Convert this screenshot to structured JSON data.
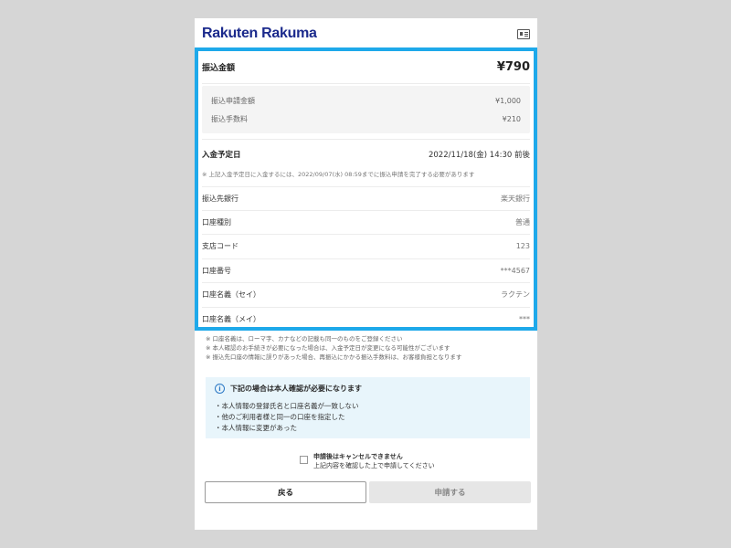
{
  "header": {
    "logo": "Rakuten Rakuma",
    "menu_icon": "id-card-icon"
  },
  "summary": {
    "amount_label": "振込金額",
    "amount_value": "¥790",
    "breakdown": [
      {
        "label": "振込申請金額",
        "value": "¥1,000"
      },
      {
        "label": "振込手数料",
        "value": "¥210"
      }
    ]
  },
  "deposit": {
    "label": "入金予定日",
    "value": "2022/11/18(金) 14:30 前後",
    "note": "※ 上記入金予定日に入金するには、2022/09/07(水) 08:59までに振込申請を完了する必要があります"
  },
  "details": [
    {
      "label": "振込先銀行",
      "value": "楽天銀行"
    },
    {
      "label": "口座種別",
      "value": "普通"
    },
    {
      "label": "支店コード",
      "value": "123"
    },
    {
      "label": "口座番号",
      "value": "***4567"
    },
    {
      "label": "口座名義（セイ）",
      "value": "ラクテン"
    },
    {
      "label": "口座名義（メイ）",
      "value": "***"
    }
  ],
  "notes": [
    "※ 口座名義は、ローマ字、カナなどの記載も同一のものをご登録ください",
    "※ 本人確認のお手続きが必要になった場合は、入金予定日が変更になる可能性がございます",
    "※ 振込先口座の情報に誤りがあった場合、再振込にかかる振込手数料は、お客様負担となります"
  ],
  "info": {
    "title": "下記の場合は本人確認が必要になります",
    "items": [
      "・本人情報の登録氏名と口座名義が一致しない",
      "・他のご利用者様と同一の口座を指定した",
      "・本人情報に変更があった"
    ]
  },
  "agreement": {
    "title": "申請後はキャンセルできません",
    "subtitle": "上記内容を確認した上で申請してください"
  },
  "buttons": {
    "back": "戻る",
    "apply": "申請する"
  },
  "colors": {
    "highlight": "#1ea9ea",
    "brand": "#1b2a8c",
    "info_bg": "#e8f5fb"
  }
}
